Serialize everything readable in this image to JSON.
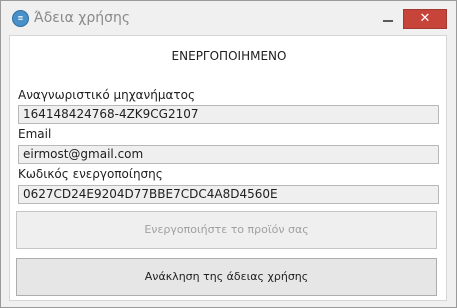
{
  "window": {
    "title": "Άδεια χρήσης",
    "icon": "license-icon",
    "icon_text": "≡",
    "close_glyph": "✕",
    "close_color": "#c7443a"
  },
  "status": "ΕΝΕΡΓΟΠΟΙΗΜΕΝΟ",
  "fields": {
    "machine_id": {
      "label": "Αναγνωριστικό μηχανήματος",
      "value": "164148424768-4ZK9CG2107"
    },
    "email": {
      "label": "Email",
      "value": "eirmost@gmail.com"
    },
    "activation_code": {
      "label": "Κωδικός ενεργοποίησης",
      "value": "0627CD24E9204D77BBE7CDC4A8D4560E"
    }
  },
  "buttons": {
    "activate": "Ενεργοποιήστε το προϊόν σας",
    "revoke": "Ανάκληση της άδειας χρήσης"
  }
}
